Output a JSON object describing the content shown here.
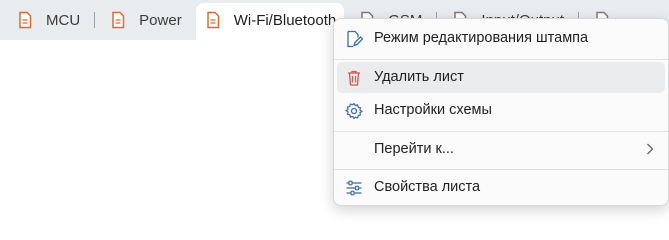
{
  "tabs": [
    {
      "label": "MCU"
    },
    {
      "label": "Power"
    },
    {
      "label": "Wi-Fi/Bluetooth"
    },
    {
      "label": "GSM"
    },
    {
      "label": "Input/Output"
    }
  ],
  "context_menu": {
    "items": [
      {
        "label": "Режим редактирования штампа",
        "icon": "edit-stamp-icon"
      },
      {
        "label": "Удалить лист",
        "icon": "trash-icon"
      },
      {
        "label": "Настройки схемы",
        "icon": "gear-icon"
      },
      {
        "label": "Перейти к...",
        "icon": "chevron-right-icon"
      },
      {
        "label": "Свойства листа",
        "icon": "sliders-icon"
      }
    ]
  },
  "colors": {
    "accent": "#e06c2b",
    "danger": "#d9534f",
    "icon": "#3a6ea5"
  }
}
